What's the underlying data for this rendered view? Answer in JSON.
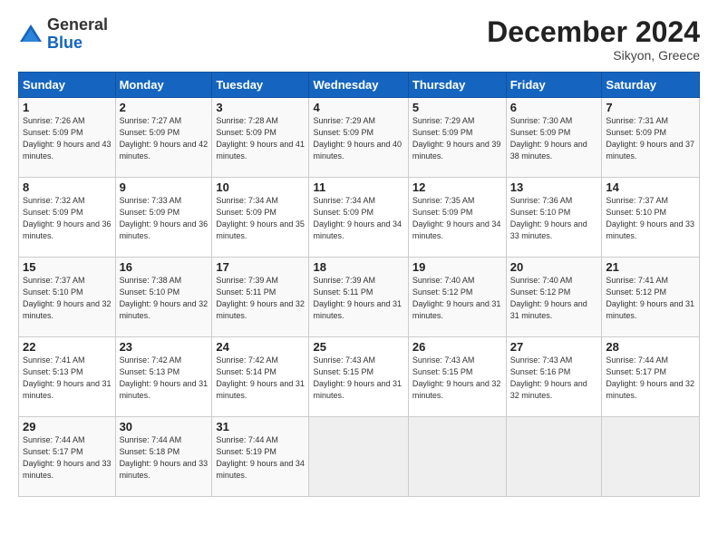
{
  "header": {
    "logo_general": "General",
    "logo_blue": "Blue",
    "month_title": "December 2024",
    "location": "Sikyon, Greece"
  },
  "calendar": {
    "days_of_week": [
      "Sunday",
      "Monday",
      "Tuesday",
      "Wednesday",
      "Thursday",
      "Friday",
      "Saturday"
    ],
    "weeks": [
      [
        {
          "day": "1",
          "sunrise": "7:26 AM",
          "sunset": "5:09 PM",
          "daylight": "9 hours and 43 minutes."
        },
        {
          "day": "2",
          "sunrise": "7:27 AM",
          "sunset": "5:09 PM",
          "daylight": "9 hours and 42 minutes."
        },
        {
          "day": "3",
          "sunrise": "7:28 AM",
          "sunset": "5:09 PM",
          "daylight": "9 hours and 41 minutes."
        },
        {
          "day": "4",
          "sunrise": "7:29 AM",
          "sunset": "5:09 PM",
          "daylight": "9 hours and 40 minutes."
        },
        {
          "day": "5",
          "sunrise": "7:29 AM",
          "sunset": "5:09 PM",
          "daylight": "9 hours and 39 minutes."
        },
        {
          "day": "6",
          "sunrise": "7:30 AM",
          "sunset": "5:09 PM",
          "daylight": "9 hours and 38 minutes."
        },
        {
          "day": "7",
          "sunrise": "7:31 AM",
          "sunset": "5:09 PM",
          "daylight": "9 hours and 37 minutes."
        }
      ],
      [
        {
          "day": "8",
          "sunrise": "7:32 AM",
          "sunset": "5:09 PM",
          "daylight": "9 hours and 36 minutes."
        },
        {
          "day": "9",
          "sunrise": "7:33 AM",
          "sunset": "5:09 PM",
          "daylight": "9 hours and 36 minutes."
        },
        {
          "day": "10",
          "sunrise": "7:34 AM",
          "sunset": "5:09 PM",
          "daylight": "9 hours and 35 minutes."
        },
        {
          "day": "11",
          "sunrise": "7:34 AM",
          "sunset": "5:09 PM",
          "daylight": "9 hours and 34 minutes."
        },
        {
          "day": "12",
          "sunrise": "7:35 AM",
          "sunset": "5:09 PM",
          "daylight": "9 hours and 34 minutes."
        },
        {
          "day": "13",
          "sunrise": "7:36 AM",
          "sunset": "5:10 PM",
          "daylight": "9 hours and 33 minutes."
        },
        {
          "day": "14",
          "sunrise": "7:37 AM",
          "sunset": "5:10 PM",
          "daylight": "9 hours and 33 minutes."
        }
      ],
      [
        {
          "day": "15",
          "sunrise": "7:37 AM",
          "sunset": "5:10 PM",
          "daylight": "9 hours and 32 minutes."
        },
        {
          "day": "16",
          "sunrise": "7:38 AM",
          "sunset": "5:10 PM",
          "daylight": "9 hours and 32 minutes."
        },
        {
          "day": "17",
          "sunrise": "7:39 AM",
          "sunset": "5:11 PM",
          "daylight": "9 hours and 32 minutes."
        },
        {
          "day": "18",
          "sunrise": "7:39 AM",
          "sunset": "5:11 PM",
          "daylight": "9 hours and 31 minutes."
        },
        {
          "day": "19",
          "sunrise": "7:40 AM",
          "sunset": "5:12 PM",
          "daylight": "9 hours and 31 minutes."
        },
        {
          "day": "20",
          "sunrise": "7:40 AM",
          "sunset": "5:12 PM",
          "daylight": "9 hours and 31 minutes."
        },
        {
          "day": "21",
          "sunrise": "7:41 AM",
          "sunset": "5:12 PM",
          "daylight": "9 hours and 31 minutes."
        }
      ],
      [
        {
          "day": "22",
          "sunrise": "7:41 AM",
          "sunset": "5:13 PM",
          "daylight": "9 hours and 31 minutes."
        },
        {
          "day": "23",
          "sunrise": "7:42 AM",
          "sunset": "5:13 PM",
          "daylight": "9 hours and 31 minutes."
        },
        {
          "day": "24",
          "sunrise": "7:42 AM",
          "sunset": "5:14 PM",
          "daylight": "9 hours and 31 minutes."
        },
        {
          "day": "25",
          "sunrise": "7:43 AM",
          "sunset": "5:15 PM",
          "daylight": "9 hours and 31 minutes."
        },
        {
          "day": "26",
          "sunrise": "7:43 AM",
          "sunset": "5:15 PM",
          "daylight": "9 hours and 32 minutes."
        },
        {
          "day": "27",
          "sunrise": "7:43 AM",
          "sunset": "5:16 PM",
          "daylight": "9 hours and 32 minutes."
        },
        {
          "day": "28",
          "sunrise": "7:44 AM",
          "sunset": "5:17 PM",
          "daylight": "9 hours and 32 minutes."
        }
      ],
      [
        {
          "day": "29",
          "sunrise": "7:44 AM",
          "sunset": "5:17 PM",
          "daylight": "9 hours and 33 minutes."
        },
        {
          "day": "30",
          "sunrise": "7:44 AM",
          "sunset": "5:18 PM",
          "daylight": "9 hours and 33 minutes."
        },
        {
          "day": "31",
          "sunrise": "7:44 AM",
          "sunset": "5:19 PM",
          "daylight": "9 hours and 34 minutes."
        },
        null,
        null,
        null,
        null
      ]
    ]
  }
}
